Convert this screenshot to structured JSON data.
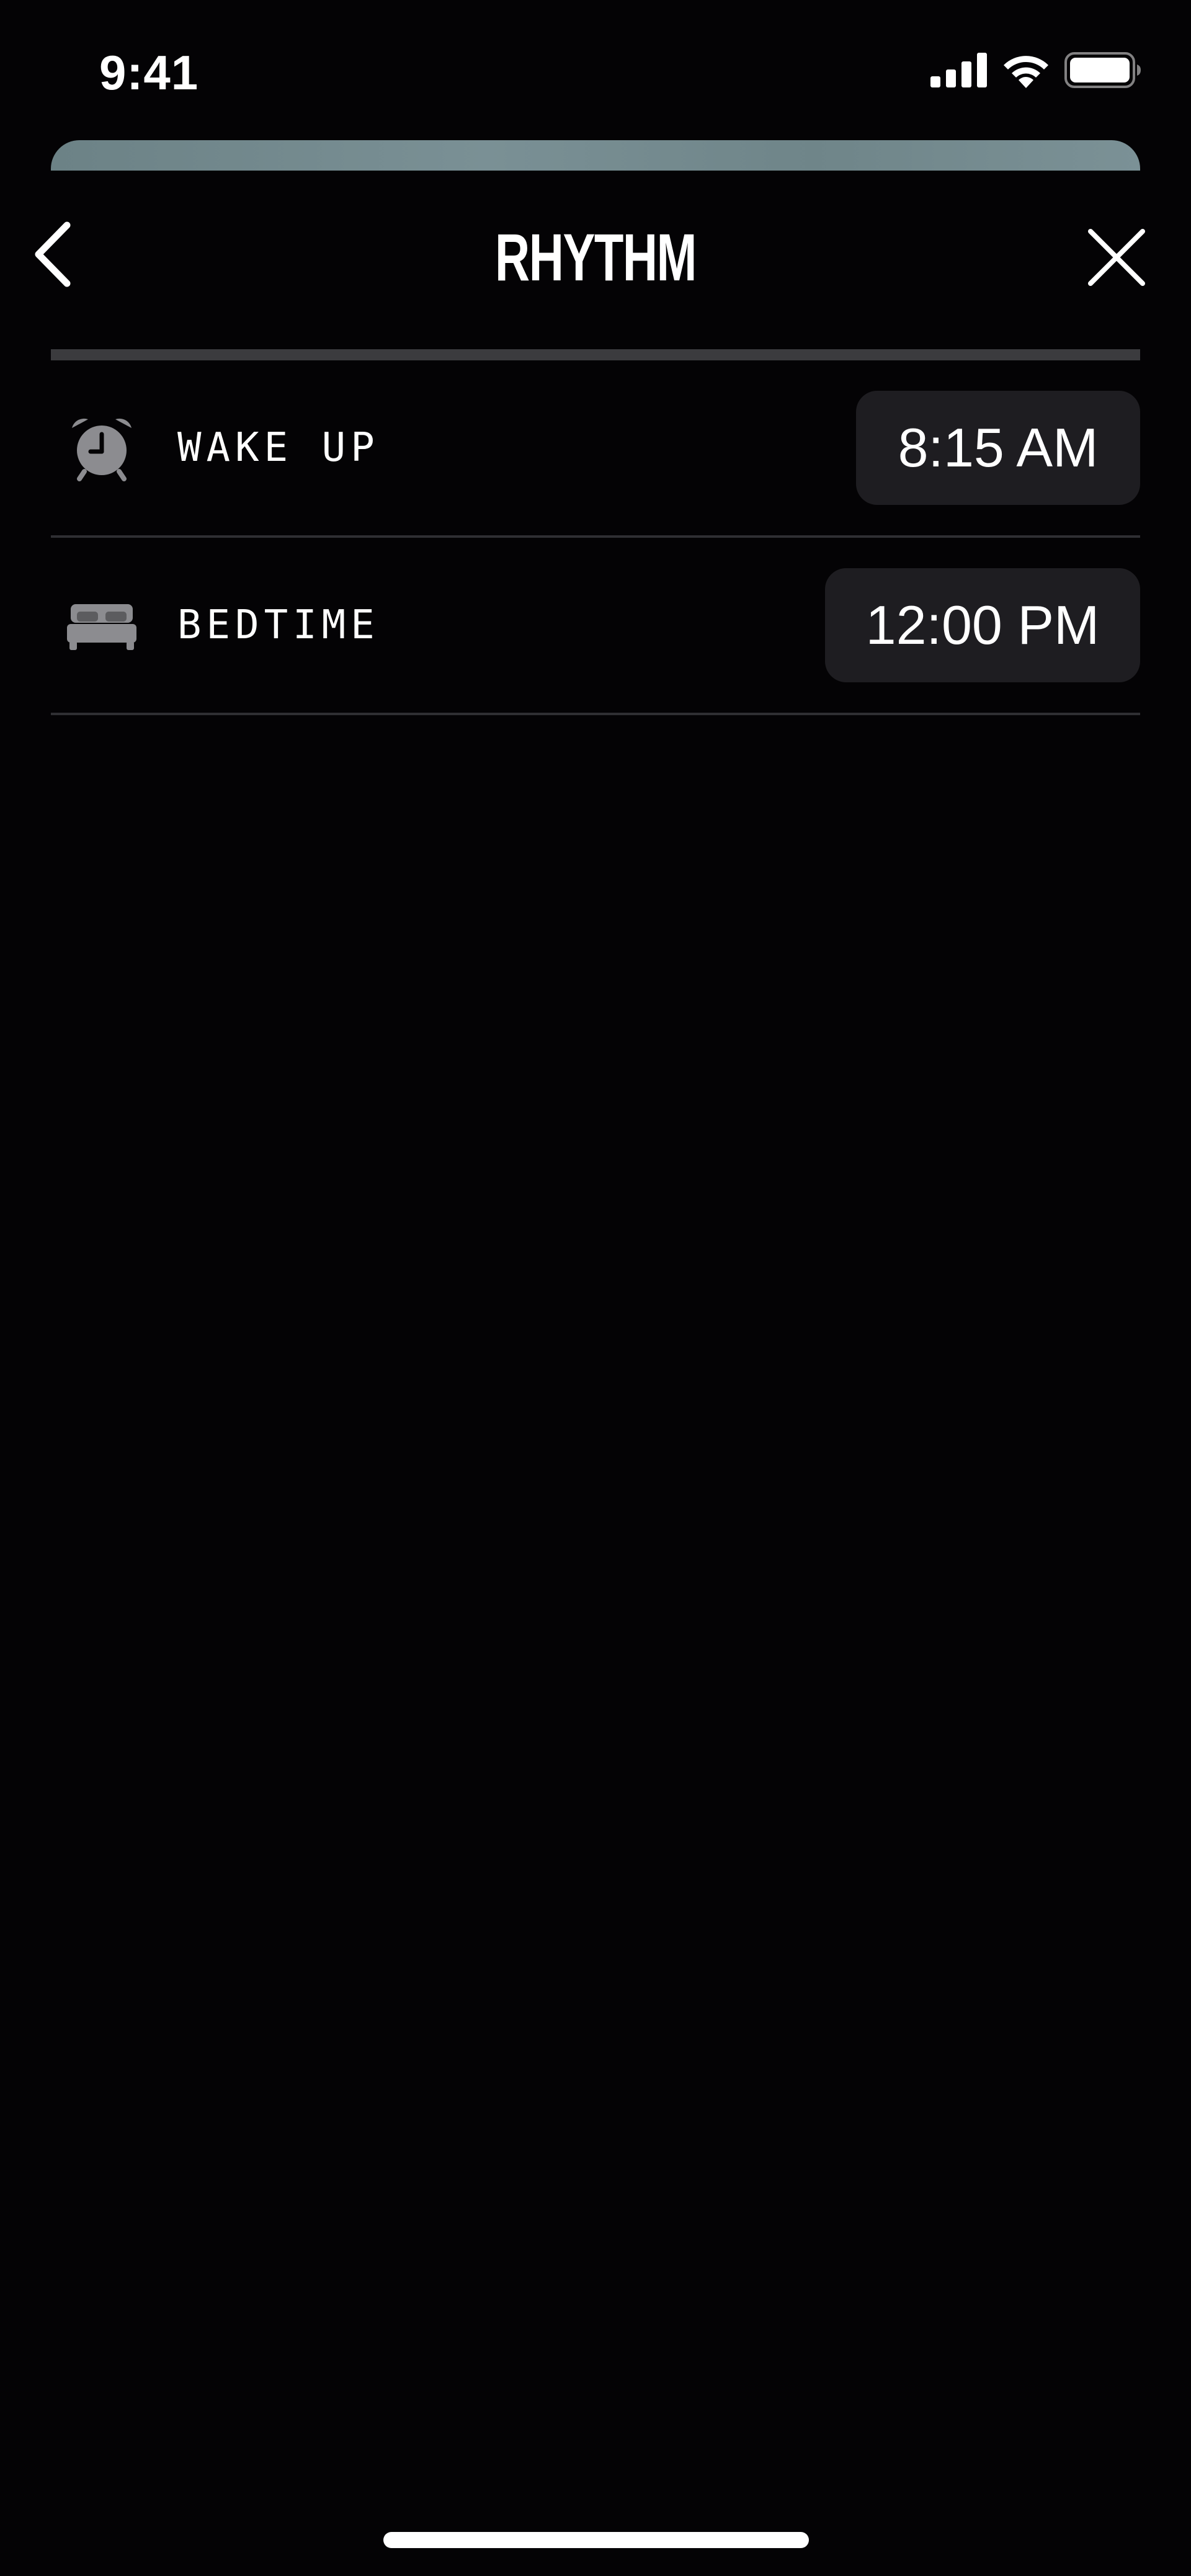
{
  "status_bar": {
    "time": "9:41",
    "icons": [
      "cellular-signal-icon",
      "wifi-icon",
      "battery-icon"
    ]
  },
  "nav": {
    "title": "RHYTHM",
    "back_icon": "chevron-left-icon",
    "close_icon": "close-icon"
  },
  "rhythm": {
    "progress": 1.0,
    "items": [
      {
        "icon": "alarm-clock-icon",
        "label": "WAKE UP",
        "time": "8:15 AM"
      },
      {
        "icon": "bed-icon",
        "label": "BEDTIME",
        "time": "12:00 PM"
      }
    ]
  },
  "colors": {
    "background": "#040305",
    "text": "#ffffff",
    "pill_background": "#1e1d21",
    "icon_gray": "#8c8c90",
    "divider": "#2f2f33",
    "progress_track": "#3b3b3e",
    "sheet_peek": "#728a8e"
  }
}
